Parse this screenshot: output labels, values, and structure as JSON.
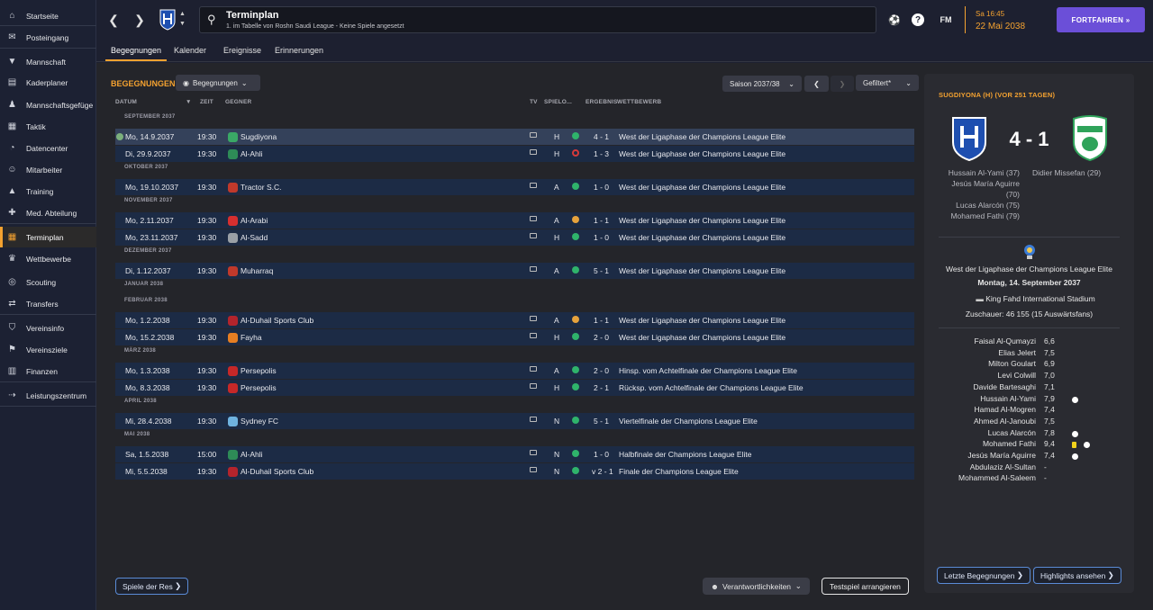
{
  "sidebar": {
    "items": [
      {
        "label": "Startseite",
        "icon": "home-icon"
      },
      {
        "label": "Posteingang",
        "icon": "inbox-icon"
      },
      {
        "label": "Mannschaft",
        "icon": "shirt-icon"
      },
      {
        "label": "Kaderplaner",
        "icon": "clipboard-icon"
      },
      {
        "label": "Mannschaftsgefüge",
        "icon": "people-icon"
      },
      {
        "label": "Taktik",
        "icon": "tactics-icon"
      },
      {
        "label": "Datencenter",
        "icon": "data-icon"
      },
      {
        "label": "Mitarbeiter",
        "icon": "staff-icon"
      },
      {
        "label": "Training",
        "icon": "training-icon"
      },
      {
        "label": "Med. Abteilung",
        "icon": "medical-icon"
      },
      {
        "label": "Terminplan",
        "icon": "calendar-icon"
      },
      {
        "label": "Wettbewerbe",
        "icon": "trophy-icon"
      },
      {
        "label": "Scouting",
        "icon": "scouting-icon"
      },
      {
        "label": "Transfers",
        "icon": "transfers-icon"
      },
      {
        "label": "Vereinsinfo",
        "icon": "shield-icon"
      },
      {
        "label": "Vereinsziele",
        "icon": "goals-icon"
      },
      {
        "label": "Finanzen",
        "icon": "finance-icon"
      },
      {
        "label": "Leistungszentrum",
        "icon": "academy-icon"
      }
    ]
  },
  "header": {
    "title": "Terminplan",
    "subtitle": "1. im Tabelle von Roshn Saudi League - Keine Spiele angesetzt",
    "fm_label": "FM",
    "time": "Sa 16:45",
    "date": "22 Mai 2038",
    "continue_label": "FORTFAHREN »"
  },
  "tabs": [
    "Begegnungen",
    "Kalender",
    "Ereignisse",
    "Erinnerungen"
  ],
  "main": {
    "section_title": "BEGEGNUNGEN",
    "view_dropdown": "Begegnungen",
    "season_dropdown": "Saison 2037/38",
    "filter_dropdown": "Gefiltert*",
    "columns": [
      "DATUM",
      "ZEIT",
      "GEGNER",
      "TV",
      "SPIELO...",
      "ERGEBNIS",
      "WETTBEWERB"
    ],
    "months": [
      "SEPTEMBER 2037",
      "OKTOBER 2037",
      "NOVEMBER 2037",
      "DEZEMBER 2037",
      "JANUAR 2038",
      "FEBRUAR 2038",
      "MÄRZ 2038",
      "APRIL 2038",
      "MAI 2038"
    ],
    "matches": [
      {
        "date": "Mo, 14.9.2037",
        "time": "19:30",
        "opponent": "Sugdiyona",
        "venue": "H",
        "result_type": "win",
        "score": "4 - 1",
        "competition": "West der Ligaphase der Champions League Elite",
        "crest_color": "#3aa866"
      },
      {
        "date": "Di, 29.9.2037",
        "time": "19:30",
        "opponent": "Al-Ahli",
        "venue": "H",
        "result_type": "loss",
        "score": "1 - 3",
        "competition": "West der Ligaphase der Champions League Elite",
        "crest_color": "#2e8b57"
      },
      {
        "date": "Mo, 19.10.2037",
        "time": "19:30",
        "opponent": "Tractor S.C.",
        "venue": "A",
        "result_type": "win",
        "score": "1 - 0",
        "competition": "West der Ligaphase der Champions League Elite",
        "crest_color": "#c0392b"
      },
      {
        "date": "Mo, 2.11.2037",
        "time": "19:30",
        "opponent": "Al-Arabi",
        "venue": "A",
        "result_type": "draw",
        "score": "1 - 1",
        "competition": "West der Ligaphase der Champions League Elite",
        "crest_color": "#d62f2f"
      },
      {
        "date": "Mo, 23.11.2037",
        "time": "19:30",
        "opponent": "Al-Sadd",
        "venue": "H",
        "result_type": "win",
        "score": "1 - 0",
        "competition": "West der Ligaphase der Champions League Elite",
        "crest_color": "#9aa0a6"
      },
      {
        "date": "Di, 1.12.2037",
        "time": "19:30",
        "opponent": "Muharraq",
        "venue": "A",
        "result_type": "win",
        "score": "5 - 1",
        "competition": "West der Ligaphase der Champions League Elite",
        "crest_color": "#c0392b"
      },
      {
        "date": "Mo, 1.2.2038",
        "time": "19:30",
        "opponent": "Al-Duhail Sports Club",
        "venue": "A",
        "result_type": "draw",
        "score": "1 - 1",
        "competition": "West der Ligaphase der Champions League Elite",
        "crest_color": "#b3242c"
      },
      {
        "date": "Mo, 15.2.2038",
        "time": "19:30",
        "opponent": "Fayha",
        "venue": "H",
        "result_type": "win",
        "score": "2 - 0",
        "competition": "West der Ligaphase der Champions League Elite",
        "crest_color": "#e67e22"
      },
      {
        "date": "Mo, 1.3.2038",
        "time": "19:30",
        "opponent": "Persepolis",
        "venue": "A",
        "result_type": "win",
        "score": "2 - 0",
        "competition": "Hinsp. vom Achtelfinale der Champions League Elite",
        "crest_color": "#c62828"
      },
      {
        "date": "Mo, 8.3.2038",
        "time": "19:30",
        "opponent": "Persepolis",
        "venue": "H",
        "result_type": "win",
        "score": "2 - 1",
        "competition": "Rücksp. vom Achtelfinale der Champions League Elite",
        "crest_color": "#c62828"
      },
      {
        "date": "Mi, 28.4.2038",
        "time": "19:30",
        "opponent": "Sydney FC",
        "venue": "N",
        "result_type": "win",
        "score": "5 - 1",
        "competition": "Viertelfinale der Champions League Elite",
        "crest_color": "#6fb3e0"
      },
      {
        "date": "Sa, 1.5.2038",
        "time": "15:00",
        "opponent": "Al-Ahli",
        "venue": "N",
        "result_type": "win",
        "score": "1 - 0",
        "competition": "Halbfinale der Champions League Elite",
        "crest_color": "#2e8b57"
      },
      {
        "date": "Mi, 5.5.2038",
        "time": "19:30",
        "opponent": "Al-Duhail Sports Club",
        "venue": "N",
        "result_type": "win",
        "score": "v 2 - 1",
        "competition": "Finale der Champions League Elite",
        "crest_color": "#b3242c"
      }
    ],
    "bottom_left_btn": "Spiele der Res",
    "responsibilities_btn": "Verantwortlichkeiten",
    "friendly_btn": "Testspiel arrangieren"
  },
  "colors": {
    "accent": "#f4a230",
    "win": "#2fb36b",
    "draw": "#e6a23c",
    "loss": "#d63a3a",
    "button": "#6b4fd8"
  },
  "panel": {
    "title": "SUGDIYONA (H) (VOR 251 TAGEN)",
    "score": "4 - 1",
    "home_scorers": [
      "Hussain Al-Yami (37)",
      "Jesús María Aguirre",
      "(70)",
      "Lucas Alarcón (75)",
      "Mohamed Fathi (79)"
    ],
    "away_scorers": [
      "Didier Missefan (29)"
    ],
    "competition": "West der Ligaphase der Champions League Elite",
    "date": "Montag, 14. September 2037",
    "stadium": "King Fahd International Stadium",
    "attendance": "Zuschauer: 46 155 (15 Auswärtsfans)",
    "players": [
      {
        "name": "Faisal Al-Qumayzi",
        "rating": "6,6",
        "icons": []
      },
      {
        "name": "Elias Jelert",
        "rating": "7,5",
        "icons": []
      },
      {
        "name": "Milton Goulart",
        "rating": "6,9",
        "icons": []
      },
      {
        "name": "Levi Colwill",
        "rating": "7,0",
        "icons": []
      },
      {
        "name": "Davide Bartesaghi",
        "rating": "7,1",
        "icons": []
      },
      {
        "name": "Hussain Al-Yami",
        "rating": "7,9",
        "icons": [
          "ball"
        ]
      },
      {
        "name": "Hamad Al-Mogren",
        "rating": "7,4",
        "icons": []
      },
      {
        "name": "Ahmed Al-Janoubi",
        "rating": "7,5",
        "icons": []
      },
      {
        "name": "Lucas Alarcón",
        "rating": "7,8",
        "icons": [
          "ball"
        ]
      },
      {
        "name": "Mohamed Fathi",
        "rating": "9,4",
        "icons": [
          "card",
          "ball"
        ]
      },
      {
        "name": "Jesús María Aguirre",
        "rating": "7,4",
        "icons": [
          "ball"
        ]
      },
      {
        "name": "Abdulaziz Al-Sultan",
        "rating": "-",
        "icons": []
      },
      {
        "name": "Mohammed Al-Saleem",
        "rating": "-",
        "icons": []
      }
    ],
    "btn_last": "Letzte Begegnungen",
    "btn_highlights": "Highlights ansehen"
  }
}
